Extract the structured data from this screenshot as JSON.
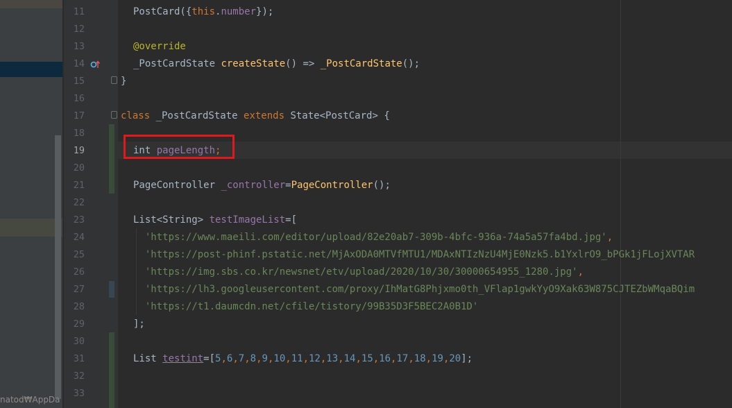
{
  "left_panel": {
    "path_fragment": "natod₩AppDa"
  },
  "lines": [
    {
      "n": "11",
      "tokens": [
        {
          "t": "PostCard({",
          "c": "plain"
        },
        {
          "t": "this",
          "c": "kw"
        },
        {
          "t": ".",
          "c": "plain"
        },
        {
          "t": "number",
          "c": "field"
        },
        {
          "t": "});",
          "c": "plain"
        }
      ]
    },
    {
      "n": "12",
      "tokens": []
    },
    {
      "n": "13",
      "tokens": [
        {
          "t": "@override",
          "c": "ann"
        }
      ]
    },
    {
      "n": "14",
      "tokens": [
        {
          "t": "_PostCardState ",
          "c": "plain"
        },
        {
          "t": "createState",
          "c": "fn"
        },
        {
          "t": "() => ",
          "c": "plain"
        },
        {
          "t": "_PostCardState",
          "c": "fn"
        },
        {
          "t": "();",
          "c": "plain"
        }
      ]
    },
    {
      "n": "15",
      "tokens": [
        {
          "t": "}",
          "c": "plain"
        }
      ]
    },
    {
      "n": "16",
      "tokens": []
    },
    {
      "n": "17",
      "tokens": [
        {
          "t": "class ",
          "c": "kw"
        },
        {
          "t": "_PostCardState ",
          "c": "plain"
        },
        {
          "t": "extends ",
          "c": "kw"
        },
        {
          "t": "State<PostCard> {",
          "c": "plain"
        }
      ]
    },
    {
      "n": "18",
      "tokens": []
    },
    {
      "n": "19",
      "tokens": [
        {
          "t": "int ",
          "c": "plain"
        },
        {
          "t": "pageLength",
          "c": "field"
        },
        {
          "t": ";",
          "c": "kw"
        }
      ]
    },
    {
      "n": "20",
      "tokens": []
    },
    {
      "n": "21",
      "tokens": [
        {
          "t": "PageController ",
          "c": "plain"
        },
        {
          "t": "_controller",
          "c": "field"
        },
        {
          "t": "=",
          "c": "plain"
        },
        {
          "t": "PageController",
          "c": "fn"
        },
        {
          "t": "();",
          "c": "plain"
        }
      ]
    },
    {
      "n": "22",
      "tokens": []
    },
    {
      "n": "23",
      "tokens": [
        {
          "t": "List<String> ",
          "c": "plain"
        },
        {
          "t": "testImageList",
          "c": "field"
        },
        {
          "t": "=[",
          "c": "plain"
        }
      ]
    },
    {
      "n": "24",
      "tokens": [
        {
          "t": "  'https://www.maeili.com/editor/upload/82e20ab7-309b-4bfc-936a-74a5a57fa4bd.jpg'",
          "c": "str"
        },
        {
          "t": ",",
          "c": "kw"
        }
      ]
    },
    {
      "n": "25",
      "tokens": [
        {
          "t": "  'https://post-phinf.pstatic.net/MjAxODA0MTVfMTU1/MDAxNTIzNzU4MjE0Nzk5.b1YxlrO9_bPGk1jFLojXVTAR",
          "c": "str"
        }
      ]
    },
    {
      "n": "26",
      "tokens": [
        {
          "t": "  'https://img.sbs.co.kr/newsnet/etv/upload/2020/10/30/30000654955_1280.jpg'",
          "c": "str"
        },
        {
          "t": ",",
          "c": "kw"
        }
      ]
    },
    {
      "n": "27",
      "tokens": [
        {
          "t": "  'https://lh3.googleusercontent.com/proxy/IhMatG8Phjxmo0th_VFlap1gwkYyO9Xak63W875CJTEZbWMqaBQim",
          "c": "str"
        }
      ]
    },
    {
      "n": "28",
      "tokens": [
        {
          "t": "  'https://t1.daumcdn.net/cfile/tistory/99B35D3F5BEC2A0B1D'",
          "c": "str"
        }
      ]
    },
    {
      "n": "29",
      "tokens": [
        {
          "t": "];",
          "c": "plain"
        }
      ]
    },
    {
      "n": "30",
      "tokens": []
    },
    {
      "n": "31",
      "tokens": [
        {
          "t": "List ",
          "c": "plain"
        },
        {
          "t": "testint",
          "c": "field und"
        },
        {
          "t": "=[",
          "c": "plain"
        },
        {
          "t": "5",
          "c": "num"
        },
        {
          "t": ",",
          "c": "kw"
        },
        {
          "t": "6",
          "c": "num"
        },
        {
          "t": ",",
          "c": "kw"
        },
        {
          "t": "7",
          "c": "num"
        },
        {
          "t": ",",
          "c": "kw"
        },
        {
          "t": "8",
          "c": "num"
        },
        {
          "t": ",",
          "c": "kw"
        },
        {
          "t": "9",
          "c": "num"
        },
        {
          "t": ",",
          "c": "kw"
        },
        {
          "t": "10",
          "c": "num"
        },
        {
          "t": ",",
          "c": "kw"
        },
        {
          "t": "11",
          "c": "num"
        },
        {
          "t": ",",
          "c": "kw"
        },
        {
          "t": "12",
          "c": "num"
        },
        {
          "t": ",",
          "c": "kw"
        },
        {
          "t": "13",
          "c": "num"
        },
        {
          "t": ",",
          "c": "kw"
        },
        {
          "t": "14",
          "c": "num"
        },
        {
          "t": ",",
          "c": "kw"
        },
        {
          "t": "15",
          "c": "num"
        },
        {
          "t": ",",
          "c": "kw"
        },
        {
          "t": "16",
          "c": "num"
        },
        {
          "t": ",",
          "c": "kw"
        },
        {
          "t": "17",
          "c": "num"
        },
        {
          "t": ",",
          "c": "kw"
        },
        {
          "t": "18",
          "c": "num"
        },
        {
          "t": ",",
          "c": "kw"
        },
        {
          "t": "19",
          "c": "num"
        },
        {
          "t": ",",
          "c": "kw"
        },
        {
          "t": "20",
          "c": "num"
        },
        {
          "t": "];",
          "c": "plain"
        }
      ]
    },
    {
      "n": "32",
      "tokens": []
    },
    {
      "n": "33",
      "tokens": []
    }
  ],
  "active_line": "19",
  "highlighted_line": "19",
  "gutter_icon": "override-icon"
}
